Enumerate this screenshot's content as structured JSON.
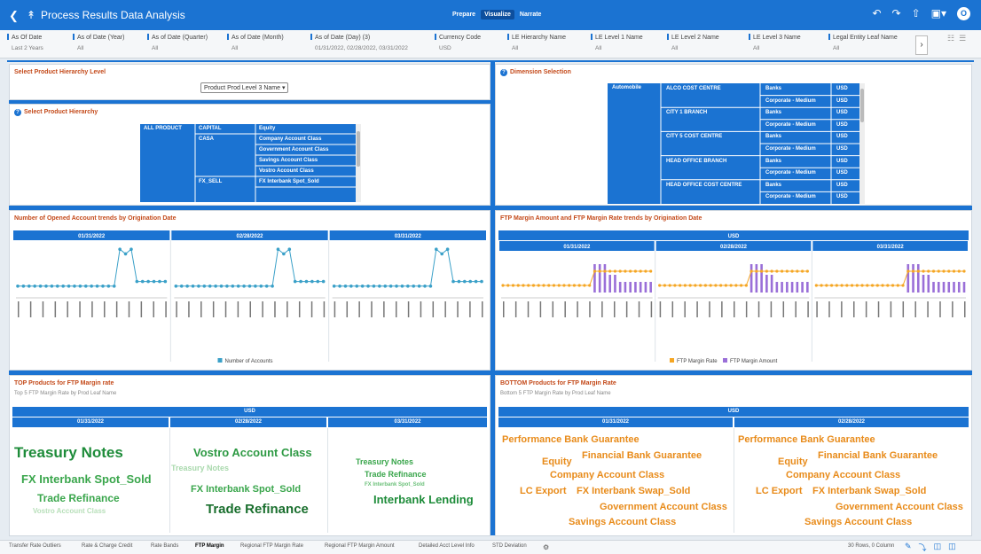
{
  "app": {
    "title": "Process Results Data Analysis",
    "modes": [
      "Prepare",
      "Visualize",
      "Narrate"
    ],
    "active_mode": "Visualize",
    "user_initial": "O",
    "accent": "#1b73d2",
    "header_color": "#c44a1a"
  },
  "filters": [
    {
      "label": "As Of Date",
      "value": "Last 2 Years"
    },
    {
      "label": "As of Date (Year)",
      "value": "All"
    },
    {
      "label": "As of Date (Quarter)",
      "value": "All"
    },
    {
      "label": "As of Date (Month)",
      "value": "All"
    },
    {
      "label": "As of Date (Day) (3)",
      "value": "01/31/2022, 02/28/2022, 03/31/2022"
    },
    {
      "label": "Currency Code",
      "value": "USD"
    },
    {
      "label": "LE Hierarchy Name",
      "value": "All"
    },
    {
      "label": "LE Level 1 Name",
      "value": "All"
    },
    {
      "label": "LE Level 2 Name",
      "value": "All"
    },
    {
      "label": "LE Level 3 Name",
      "value": "All"
    },
    {
      "label": "Legal Entity Leaf Name",
      "value": "All"
    }
  ],
  "product_level": {
    "title": "Select Product Hierarchy Level",
    "selected": "Product Prod Level 3 Name"
  },
  "product_hierarchy": {
    "title": "Select Product Hierarchy",
    "level1": "ALL PRODUCT",
    "groups": [
      {
        "name": "CAPITAL",
        "items": [
          "Equity"
        ]
      },
      {
        "name": "CASA",
        "items": [
          "Company Account Class",
          "Government Account Class",
          "Savings Account Class",
          "Vostro Account Class"
        ]
      },
      {
        "name": "FX_SELL",
        "items": [
          "FX Interbank Spot_Sold"
        ]
      }
    ]
  },
  "dimension": {
    "title": "Dimension Selection",
    "level1": "Automobile",
    "rows": [
      {
        "centre": "ALCO COST CENTRE",
        "items": [
          [
            "Banks",
            "USD"
          ],
          [
            "Corporate - Medium",
            "USD"
          ]
        ]
      },
      {
        "centre": "CITY 1 BRANCH",
        "items": [
          [
            "Banks",
            "USD"
          ],
          [
            "Corporate - Medium",
            "USD"
          ]
        ]
      },
      {
        "centre": "CITY 5 COST CENTRE",
        "items": [
          [
            "Banks",
            "USD"
          ],
          [
            "Corporate - Medium",
            "USD"
          ]
        ]
      },
      {
        "centre": "HEAD OFFICE BRANCH",
        "items": [
          [
            "Banks",
            "USD"
          ],
          [
            "Corporate - Medium",
            "USD"
          ]
        ]
      },
      {
        "centre": "HEAD OFFICE COST CENTRE",
        "items": [
          [
            "Banks",
            "USD"
          ],
          [
            "Corporate - Medium",
            "USD"
          ]
        ]
      }
    ]
  },
  "chart_data": [
    {
      "type": "line",
      "title": "Number of Opened Account trends by Origination Date",
      "facets": [
        "01/31/2022",
        "02/28/2022",
        "03/31/2022"
      ],
      "legend": "bottom-center",
      "series": [
        {
          "name": "Number of Accounts",
          "color": "#3aa0c8",
          "facet_values": [
            [
              1,
              1,
              1,
              1,
              1,
              1,
              1,
              1,
              1,
              1,
              1,
              1,
              1,
              1,
              1,
              1,
              1,
              1,
              9,
              8,
              9,
              2,
              2,
              2,
              2,
              2,
              2
            ],
            [
              1,
              1,
              1,
              1,
              1,
              1,
              1,
              1,
              1,
              1,
              1,
              1,
              1,
              1,
              1,
              1,
              1,
              1,
              9,
              8,
              9,
              2,
              2,
              2,
              2,
              2,
              2
            ],
            [
              1,
              1,
              1,
              1,
              1,
              1,
              1,
              1,
              1,
              1,
              1,
              1,
              1,
              1,
              1,
              1,
              1,
              1,
              9,
              8,
              9,
              2,
              2,
              2,
              2,
              2,
              2
            ]
          ]
        }
      ]
    },
    {
      "type": "bar",
      "title": "FTP Margin Amount and FTP Margin Rate trends by Origination Date",
      "group": "USD",
      "facets": [
        "01/31/2022",
        "02/28/2022",
        "03/31/2022"
      ],
      "legend": "bottom-center",
      "series": [
        {
          "name": "FTP Margin Rate",
          "color": "#f5a623",
          "chart": "line",
          "values": [
            1,
            1,
            1,
            1,
            1,
            1,
            1,
            1,
            1,
            1,
            1,
            1,
            1,
            1,
            1,
            1,
            1,
            1,
            3,
            3,
            3,
            3,
            3,
            3,
            3,
            3,
            3,
            3,
            3,
            3
          ]
        },
        {
          "name": "FTP Margin Amount",
          "color": "#9a6fd8",
          "chart": "bar",
          "values": [
            0,
            0,
            0,
            0,
            0,
            0,
            0,
            0,
            0,
            0,
            0,
            0,
            0,
            0,
            0,
            0,
            0,
            0,
            4,
            4,
            4,
            2.5,
            2.5,
            1.5,
            1.5,
            1.5,
            1.5,
            1.5,
            1.5,
            1.5
          ]
        }
      ]
    }
  ],
  "top_products": {
    "title": "TOP Products for FTP Margin rate",
    "subtitle": "Top 5 FTP Margin Rate by Prod Leaf Name",
    "currency": "USD",
    "dates": [
      "01/31/2022",
      "02/28/2022",
      "03/31/2022"
    ],
    "col1": [
      "Treasury Notes",
      "FX Interbank Spot_Sold",
      "Trade Refinance",
      "Vostro Account Class"
    ],
    "col2": [
      "Vostro Account Class",
      "Treasury Notes",
      "FX Interbank Spot_Sold",
      "Trade Refinance"
    ],
    "col3": [
      "Treasury Notes",
      "Trade Refinance",
      "FX Interbank Spot_Sold",
      "Interbank Lending"
    ]
  },
  "bottom_products": {
    "title": "BOTTOM Products for FTP Margin Rate",
    "subtitle": "Bottom 5 FTP Margin Rate by Prod Leaf Name",
    "currency": "USD",
    "dates": [
      "01/31/2022",
      "02/28/2022"
    ],
    "words": [
      "Performance Bank Guarantee",
      "Equity",
      "Financial Bank Guarantee",
      "Company Account Class",
      "LC Export",
      "FX Interbank Swap_Sold",
      "Government Account Class",
      "Savings Account Class"
    ]
  },
  "bottom_tabs": [
    "Transfer Rate Outliers",
    "Rate & Charge Credit",
    "Rate Bands",
    "FTP Margin",
    "Regional FTP Margin Rate",
    "Regional FTP Margin Amount",
    "Detailed Acct Level Info",
    "STD Deviation"
  ],
  "active_tab": "FTP Margin",
  "status": "30 Rows, 0 Column"
}
